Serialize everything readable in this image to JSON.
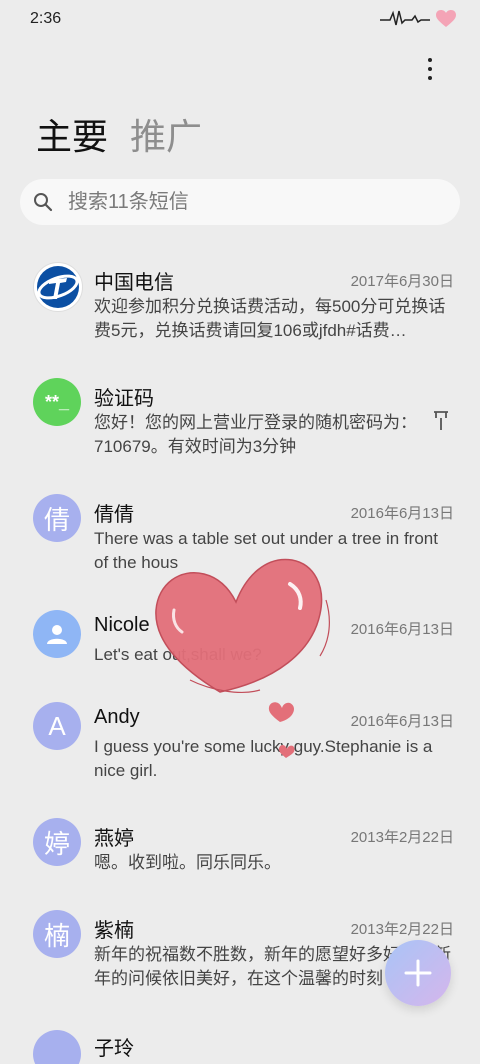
{
  "status": {
    "time": "2:36"
  },
  "tabs": [
    {
      "label": "主要"
    },
    {
      "label": "推广"
    }
  ],
  "search": {
    "placeholder": "搜索11条短信"
  },
  "messages": [
    {
      "name": "中国电信",
      "date": "2017年6月30日",
      "preview": "欢迎参加积分兑换话费活动，每500分可兑换话费5元，兑换话费请回复106或jfdh#话费…",
      "avatar_text": "",
      "avatar_color": "#ffffff"
    },
    {
      "name": "验证码",
      "date": "",
      "preview": "您好！您的网上营业厅登录的随机密码为：710679。有效时间为3分钟",
      "avatar_text": "**_",
      "avatar_color": "#5fd35b"
    },
    {
      "name": "倩倩",
      "date": "2016年6月13日",
      "preview": "There was a table set out under a tree in front of the hous",
      "avatar_text": "倩",
      "avatar_color": "#a7b0ee"
    },
    {
      "name": "Nicole",
      "date": "2016年6月13日",
      "preview": "Let's eat out,shall we?",
      "avatar_text": "",
      "avatar_color": "#8fb6f5"
    },
    {
      "name": "Andy",
      "date": "2016年6月13日",
      "preview": "I guess you're some lucky guy.Stephanie is a nice girl.",
      "avatar_text": "A",
      "avatar_color": "#a7b0ee"
    },
    {
      "name": "燕婷",
      "date": "2013年2月22日",
      "preview": "嗯。收到啦。同乐同乐。",
      "avatar_text": "婷",
      "avatar_color": "#a7b0ee"
    },
    {
      "name": "紫楠",
      "date": "2013年2月22日",
      "preview": "新年的祝福数不胜数，新年的愿望好多好多，新年的问候依旧美好，在这个温馨的时刻",
      "avatar_text": "楠",
      "avatar_color": "#a7b0ee"
    },
    {
      "name": "子玲",
      "date": "",
      "preview": "",
      "avatar_text": "",
      "avatar_color": "#a7b0ee"
    }
  ],
  "icons": {
    "search": "search-icon",
    "menu": "more-vertical-icon",
    "pin": "pin-icon",
    "fab": "plus-icon",
    "telecom": "china-telecom-logo-icon",
    "contact": "person-icon",
    "heart": "heart-icon",
    "heartbeat": "heartbeat-icon"
  },
  "colors": {
    "accent": "#a7b0ee",
    "fab_start": "#a9c4f6",
    "fab_end": "#d5b6ec",
    "heart": "#e36f79"
  }
}
